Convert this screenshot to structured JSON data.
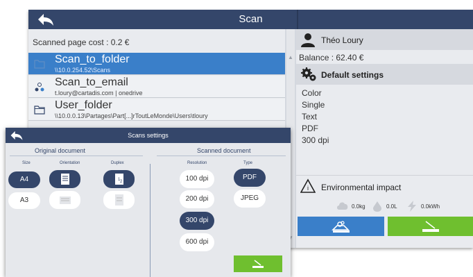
{
  "main": {
    "title": "Scan",
    "cost_line": "Scanned page cost : 0.2 €",
    "workflows": [
      {
        "name": "Scan_to_folder",
        "sub": "\\\\10.0.254.52\\Scans",
        "icon": "folder-icon",
        "selected": true
      },
      {
        "name": "Scan_to_email",
        "sub": "t.loury@cartadis.com | onedrive",
        "icon": "mail-icon",
        "selected": false
      },
      {
        "name": "User_folder",
        "sub": "\\\\10.0.0.13\\Partages\\Part[...]rToutLeMonde\\Users\\tloury",
        "icon": "folder-icon",
        "selected": false
      }
    ]
  },
  "side": {
    "user_name": "Théo Loury",
    "balance": "Balance : 62.40 €",
    "defaults_title": "Default settings",
    "defaults": [
      "Color",
      "Single",
      "Text",
      "PDF",
      "300 dpi"
    ],
    "env_title": "Environmental impact",
    "env_stats": [
      {
        "icon": "co2-cloud-icon",
        "value": "0.0kg"
      },
      {
        "icon": "water-drop-icon",
        "value": "0.0L"
      },
      {
        "icon": "lightning-icon",
        "value": "0.0kWh"
      }
    ]
  },
  "dialog": {
    "title": "Scans settings",
    "original_title": "Original document",
    "scanned_title": "Scanned document",
    "col_size": "Size",
    "col_orientation": "Orientation",
    "col_duplex": "Duplex",
    "col_resolution": "Resolution",
    "col_type": "Type",
    "sizes": [
      "A4",
      "A3"
    ],
    "selected_size": "A4",
    "resolutions": [
      "100 dpi",
      "200 dpi",
      "300 dpi",
      "600 dpi"
    ],
    "selected_resolution": "300 dpi",
    "types": [
      "PDF",
      "JPEG"
    ],
    "selected_type": "PDF"
  },
  "colors": {
    "title_bar": "#34466a",
    "selected_row": "#3a7fc9",
    "accent_green": "#6fbf2f",
    "pill_active": "#34466a"
  }
}
